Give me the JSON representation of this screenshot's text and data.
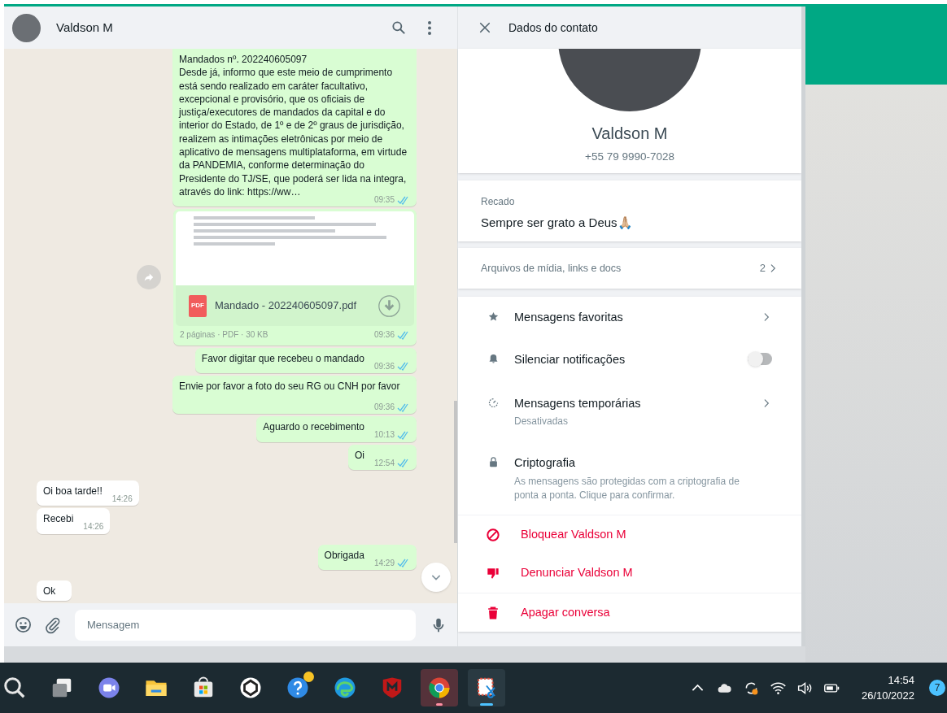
{
  "chat": {
    "header": {
      "name": "Valdson M"
    },
    "messages": [
      {
        "kind": "text",
        "outgoing": true,
        "paragraphs": [
          "Mandados nº. 202240605097",
          "Desde já, informo que este meio de cumprimento está sendo realizado em  caráter facultativo, excepcional e provisório, que os oficiais de justiça/executores de mandados da capital e do interior do Estado, de 1º e de 2º graus de jurisdição, realizem as intimações eletrônicas por meio de aplicativo de mensagens multiplataforma, em virtude da PANDEMIA, conforme determinação do Presidente do TJ/SE, que poderá ser lida na integra, através do link: https://ww…"
        ],
        "time": "09:35",
        "read": true
      },
      {
        "kind": "document",
        "outgoing": true,
        "file_name": "Mandado - 202240605097.pdf",
        "file_badge": "PDF",
        "meta": "2 páginas · PDF · 30 KB",
        "time": "09:36",
        "read": true
      },
      {
        "kind": "text",
        "outgoing": true,
        "paragraphs": [
          "Favor digitar que recebeu o mandado"
        ],
        "time": "09:36",
        "read": true
      },
      {
        "kind": "text",
        "outgoing": true,
        "paragraphs": [
          "Envie por favor a foto do seu RG ou CNH por favor"
        ],
        "time": "09:36",
        "read": true
      },
      {
        "kind": "text",
        "outgoing": true,
        "paragraphs": [
          "Aguardo o recebimento"
        ],
        "time": "10:13",
        "read": true
      },
      {
        "kind": "text",
        "outgoing": true,
        "paragraphs": [
          "Oi"
        ],
        "time": "12:54",
        "read": true
      },
      {
        "kind": "text",
        "outgoing": false,
        "paragraphs": [
          "Oi boa tarde!!"
        ],
        "time": "14:26"
      },
      {
        "kind": "text",
        "outgoing": false,
        "paragraphs": [
          "Recebi"
        ],
        "time": "14:26"
      },
      {
        "kind": "text",
        "outgoing": true,
        "paragraphs": [
          "Obrigada"
        ],
        "time": "14:29",
        "read": true
      },
      {
        "kind": "text",
        "outgoing": false,
        "paragraphs": [
          "Ok"
        ]
      }
    ],
    "composer": {
      "placeholder": "Mensagem"
    }
  },
  "contact_panel": {
    "title": "Dados do contato",
    "name": "Valdson M",
    "phone": "+55 79 9990-7028",
    "about": {
      "label": "Recado",
      "text": "Sempre ser grato a Deus🙏🏼"
    },
    "media": {
      "label": "Arquivos de mídia, links e docs",
      "count": "2"
    },
    "options": [
      {
        "kind": "link",
        "label": "Mensagens favoritas"
      },
      {
        "kind": "toggle",
        "label": "Silenciar notificações",
        "on": false
      },
      {
        "kind": "link",
        "label": "Mensagens temporárias",
        "subtitle": "Desativadas"
      },
      {
        "kind": "info",
        "label": "Criptografia",
        "subtitle": "As mensagens são protegidas com a criptografia de ponta a ponta. Clique para confirmar."
      }
    ],
    "actions": [
      {
        "label": "Bloquear Valdson M"
      },
      {
        "label": "Denunciar Valdson M"
      },
      {
        "label": "Apagar conversa"
      }
    ]
  },
  "taskbar": {
    "apps": [
      {
        "kind": "search",
        "attention": false,
        "selected": false,
        "badge": false
      },
      {
        "kind": "taskview",
        "attention": false,
        "selected": false,
        "badge": false
      },
      {
        "kind": "chat",
        "attention": false,
        "selected": false,
        "badge": false
      },
      {
        "kind": "folder",
        "attention": false,
        "selected": false,
        "badge": false
      },
      {
        "kind": "store",
        "attention": false,
        "selected": false,
        "badge": false
      },
      {
        "kind": "ring",
        "attention": false,
        "selected": false,
        "badge": false
      },
      {
        "kind": "help",
        "attention": false,
        "selected": false,
        "badge": true
      },
      {
        "kind": "browser",
        "attention": false,
        "selected": false,
        "badge": false
      },
      {
        "kind": "shield",
        "attention": false,
        "selected": false,
        "badge": false
      },
      {
        "kind": "chrome",
        "attention": true,
        "selected": false,
        "badge": false
      },
      {
        "kind": "snip",
        "attention": false,
        "selected": true,
        "badge": false
      }
    ],
    "time": "14:54",
    "date": "26/10/2022",
    "notifications": "7"
  }
}
